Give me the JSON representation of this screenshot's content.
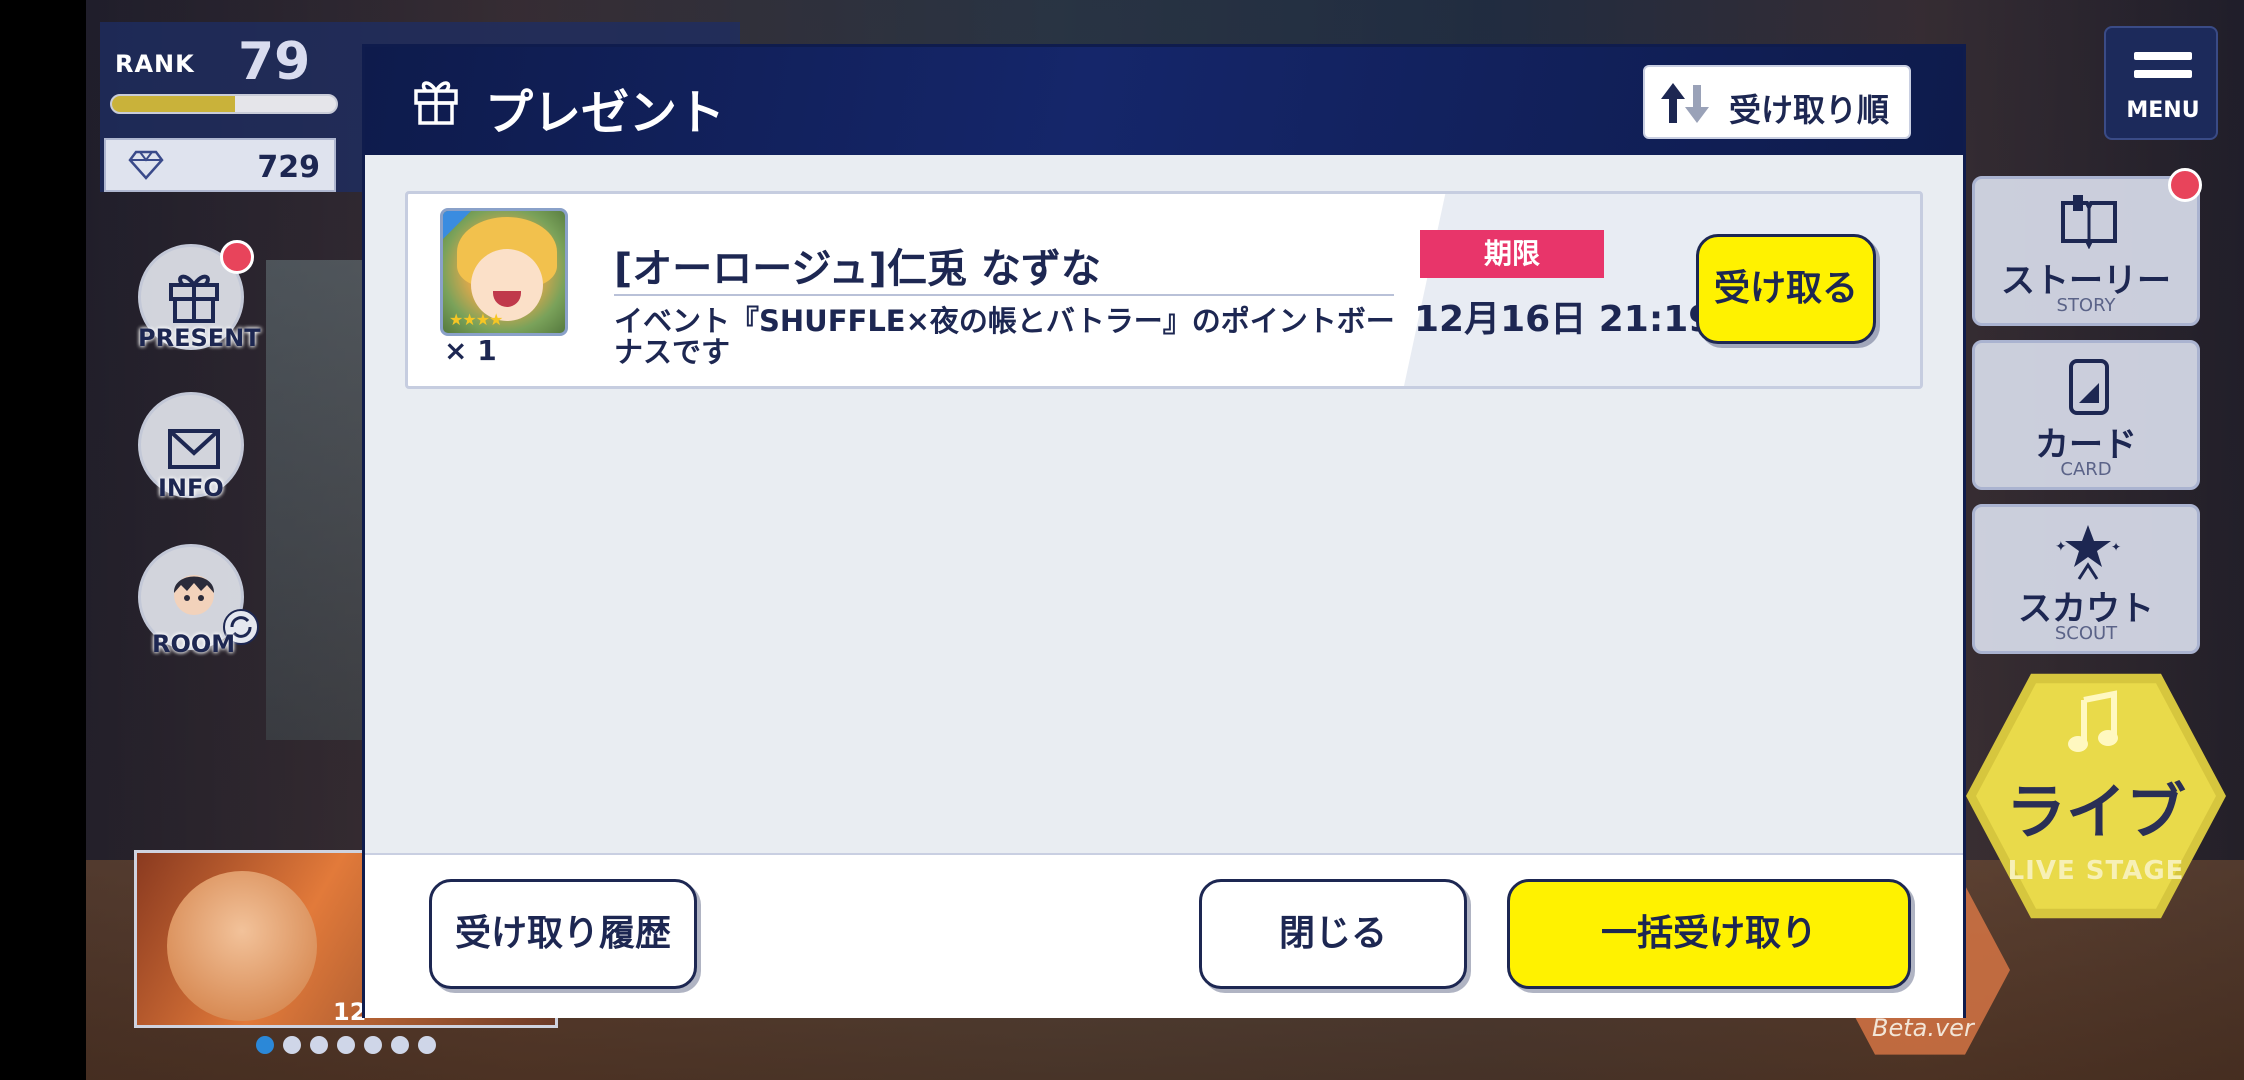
{
  "status": {
    "rank_label": "RANK",
    "rank_value": "79",
    "rank_progress": 0.55,
    "gems": "729"
  },
  "left_nav": {
    "present_label": "PRESENT",
    "info_label": "INFO",
    "room_label": "ROOM"
  },
  "banner": {
    "number": "12"
  },
  "right_nav": {
    "menu_label": "MENU",
    "story_jp": "ストーリー",
    "story_en": "STORY",
    "card_jp": "カード",
    "card_en": "CARD",
    "scout_jp": "スカウト",
    "scout_en": "SCOUT",
    "live_jp": "ライブ",
    "live_en": "LIVE STAGE",
    "beta_label": "Beta.ver"
  },
  "modal": {
    "title": "プレゼント",
    "sort_label": "受け取り順",
    "items": [
      {
        "name": "[オーロージュ]仁兎 なずな",
        "quantity": "× 1",
        "description": "イベント『SHUFFLE×夜の帳とバトラー』のポイントボーナスです",
        "deadline_label": "期限",
        "deadline": "12月16日 21:19",
        "receive_label": "受け取る"
      }
    ],
    "footer": {
      "history_label": "受け取り履歴",
      "close_label": "閉じる",
      "receive_all_label": "一括受け取り"
    }
  },
  "colors": {
    "header_navy": "#0e1b4c",
    "accent_yellow": "#fff200",
    "deadline_pink": "#e8356a",
    "text_navy": "#1d2752"
  }
}
